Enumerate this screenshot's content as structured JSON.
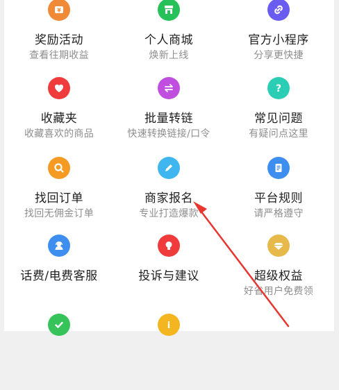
{
  "items": [
    {
      "title": "奖励活动",
      "subtitle": "查看往期收益",
      "icon": "wallet-icon",
      "color": "#f08a36"
    },
    {
      "title": "个人商城",
      "subtitle": "焕新上线",
      "icon": "store-icon",
      "color": "#27c15a"
    },
    {
      "title": "官方小程序",
      "subtitle": "分享更快捷",
      "icon": "link-icon",
      "color": "#6a5cf0"
    },
    {
      "title": "收藏夹",
      "subtitle": "收藏喜欢的商品",
      "icon": "heart-icon",
      "color": "#ef3b3b"
    },
    {
      "title": "批量转链",
      "subtitle": "快速转换链接/口令",
      "icon": "convert-icon",
      "color": "#c04fe0"
    },
    {
      "title": "常见问题",
      "subtitle": "有疑问点这里",
      "icon": "question-icon",
      "color": "#2bcdb4"
    },
    {
      "title": "找回订单",
      "subtitle": "找回无佣金订单",
      "icon": "search-icon",
      "color": "#f59a22"
    },
    {
      "title": "商家报名",
      "subtitle": "专业打造爆款",
      "icon": "edit-icon",
      "color": "#3fb6ef"
    },
    {
      "title": "平台规则",
      "subtitle": "请严格遵守",
      "icon": "document-icon",
      "color": "#3e8ef0"
    },
    {
      "title": "话费/电费客服",
      "subtitle": "",
      "icon": "customer-service-icon",
      "color": "#3e8ef0"
    },
    {
      "title": "投诉与建议",
      "subtitle": "",
      "icon": "lightbulb-icon",
      "color": "#ef3b3b"
    },
    {
      "title": "超级权益",
      "subtitle": "好省用户免费领",
      "icon": "diamond-icon",
      "color": "#e7b94a"
    },
    {
      "title": "",
      "subtitle": "",
      "icon": "check-icon",
      "color": "#35c35a"
    },
    {
      "title": "",
      "subtitle": "",
      "icon": "info-icon",
      "color": "#f3b621"
    }
  ],
  "annotation": {
    "color": "#e8362f"
  }
}
